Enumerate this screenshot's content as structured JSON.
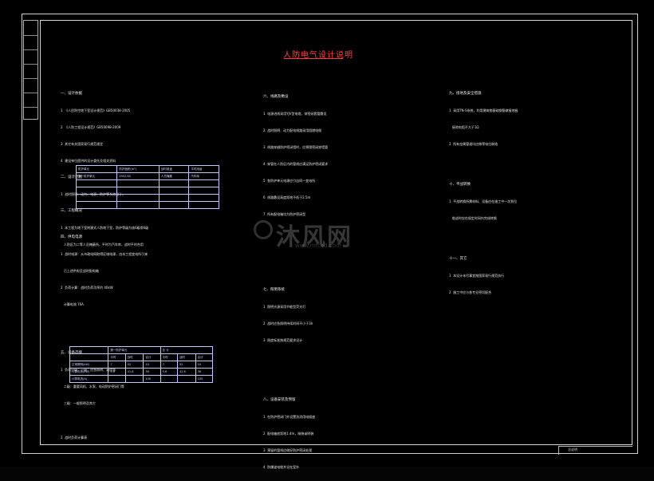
{
  "title": "人防电气设计说明",
  "watermark": {
    "brand": "沐风网",
    "site": "www.mfcad.com"
  },
  "col1": {
    "s1": "一、设计依据",
    "s1_l1": "1  《人民防空地下室设计规范》GB50038-2005",
    "s1_l2": "2  《人防工程设计规范》GB50098-2009",
    "s1_l3": "3  其它有关国家现行规范规定",
    "s1_l4": "4  建设单位提供的设计委托及相关资料",
    "s2": "二、设计范围",
    "s2_l1": "1  战时照明、动力、电源、防护等系统设计。",
    "s3": "三、工程概况",
    "s3_l1": "1  本工程为地下室附建式人防地下室，防护等级为核6级常6级",
    "s3_l2": "   人防区为二等人员掩蔽所，平时为汽车库，战时平时合用",
    "s4": "四、供电电源",
    "s4_l1": "1  战时电源：从市政电网取得区域电源，由本工程变电所引来",
    "s4_l2": "   已上述供电至战时配电箱",
    "s4_l3": "2  负荷计算：战时负荷功率约 40kW",
    "s4_l4": "   计算电流 76A",
    "s5": "五、设备选择",
    "s5_l1": "1  负荷分级：一级：应急照明、通信等",
    "s5_l2": "   二级：重要风机、水泵、电动防护密闭门等",
    "s5_l3": "   三级：一般照明及其它",
    "s5_l4": "2  战时负荷计算表"
  },
  "table1": {
    "headers": [
      "防护单元",
      "防护面积(m²)",
      "战时用途",
      "平时用途"
    ],
    "row": [
      "第一防护单元",
      "1952.60",
      "人员掩蔽",
      "汽车库"
    ]
  },
  "table2": {
    "headers": [
      "",
      "第一防护单元",
      "",
      "",
      "总  计",
      "",
      ""
    ],
    "subheaders": [
      "",
      "平时",
      "战时",
      "合计",
      "平时",
      "战时",
      "合计"
    ],
    "rows": [
      [
        "正常照明(kW)",
        "7",
        "52",
        "10",
        "7",
        "52",
        "10"
      ],
      [
        "计算负荷(kW)",
        "5.6",
        "41.6",
        "36",
        "5.6",
        "41.6",
        "36"
      ],
      [
        "计算电流(A)",
        "",
        "",
        "100",
        "",
        "",
        "100"
      ]
    ]
  },
  "col2": {
    "s6": "六、线路及敷设",
    "s6_l1": "1  电源进线采用YJV型电缆，穿密闭套管敷设",
    "s6_l2": "2  战时照明、动力配电线路采用阻燃电缆",
    "s6_l3": "3  线路穿越防护密闭墙时，应预埋密闭穿墙管",
    "s6_l4": "4  穿管在人防区内的管线应满足防护密闭要求",
    "s6_l5": "5  各防护单元电源应引自同一变电所",
    "s6_l6": "6  线路敷设高度距地不低于2.5m",
    "s6_l7": "7  所有配电箱均为防护密闭型",
    "s7": "七、照明系统",
    "s7_l1": "1  照明光源采用节能型荧光灯",
    "s7_l2": "2  战时应急照明持续时间不小于3h",
    "s7_l3": "3  照度标准按规范要求设计",
    "s8": "八、设备安装及预留",
    "s8_l1": "1  在防护密闭门外设置洗消用电插座",
    "s8_l2": "2  配电箱底距地1.4m，暗装或明装",
    "s8_l3": "3  预留的管线应做好防护密闭处理",
    "s8_l4": "4  防爆波电缆井设在室外"
  },
  "col3": {
    "s9": "九、接地及安全措施",
    "s9_l1": "1  采用TN-S系统，利用建筑物基础钢筋做接地极",
    "s9_l2": "   接地电阻不大于1Ω",
    "s9_l3": "2  所有金属管道均应做等电位联结",
    "s10": "十、平战转换",
    "s10_l1": "1  平战转换所需材料、设备应在施工中一次到位",
    "s10_l2": "   临战时应在规定时间内完成转换",
    "s11": "十一、其它",
    "s11_l1": "1  本设计未尽事宜按国家现行规范执行",
    "s11_l2": "2  施工中应与各专业密切配合"
  },
  "titleblock": {
    "label": "总说明"
  }
}
